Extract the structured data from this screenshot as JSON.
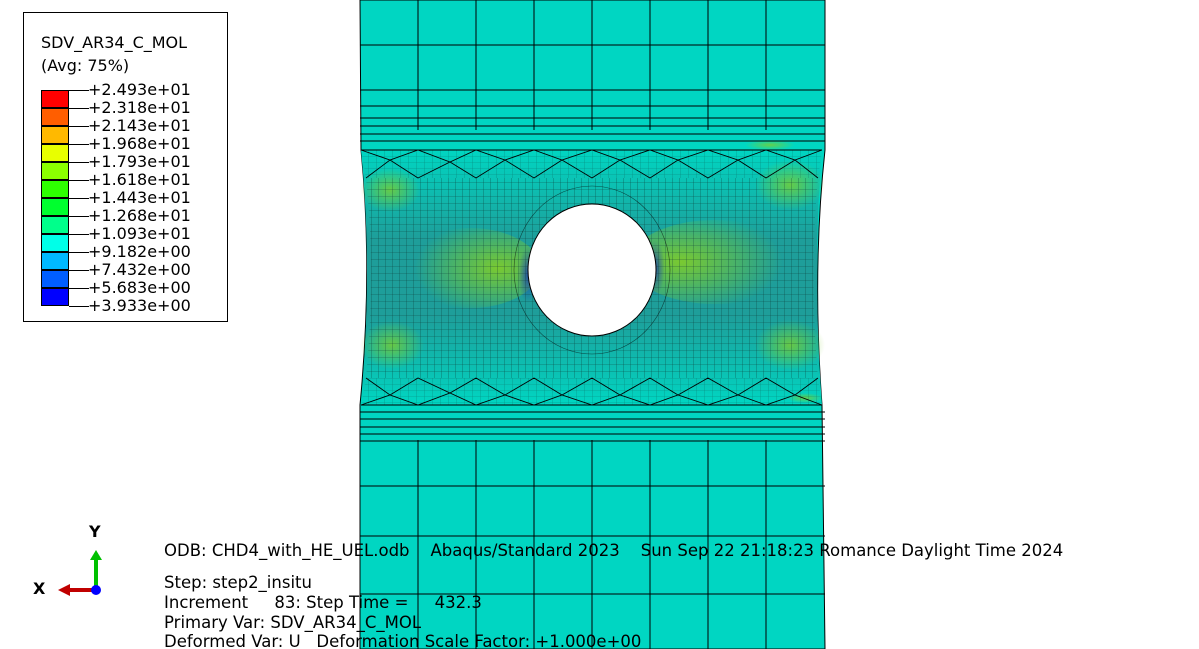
{
  "legend": {
    "variable": "SDV_AR34_C_MOL",
    "averaging": "(Avg: 75%)",
    "bands": [
      {
        "value": "+2.493e+01",
        "color": "#ff0000"
      },
      {
        "value": "+2.318e+01",
        "color": "#ff5e00"
      },
      {
        "value": "+2.143e+01",
        "color": "#ffb900"
      },
      {
        "value": "+1.968e+01",
        "color": "#e8ff00"
      },
      {
        "value": "+1.793e+01",
        "color": "#8bff00"
      },
      {
        "value": "+1.618e+01",
        "color": "#2eff00"
      },
      {
        "value": "+1.443e+01",
        "color": "#00ff2e"
      },
      {
        "value": "+1.268e+01",
        "color": "#00ff8b"
      },
      {
        "value": "+1.093e+01",
        "color": "#00ffe8"
      },
      {
        "value": "+9.182e+00",
        "color": "#00b9ff"
      },
      {
        "value": "+7.432e+00",
        "color": "#005eff"
      },
      {
        "value": "+5.683e+00",
        "color": "#0000ff"
      },
      {
        "value": "+3.933e+00",
        "color": null
      }
    ]
  },
  "info": {
    "odb_line": "ODB: CHD4_with_HE_UEL.odb    Abaqus/Standard 2023    Sun Sep 22 21:18:23 Romance Daylight Time 2024",
    "step_line": "Step: step2_insitu",
    "increment_line": "Increment     83: Step Time =     432.3",
    "primary_line": "Primary Var: SDV_AR34_C_MOL",
    "deformed_line": "Deformed Var: U   Deformation Scale Factor: +1.000e+00"
  },
  "triad": {
    "x_label": "X",
    "y_label": "Y",
    "x_color": "#c00000",
    "y_color": "#00c000",
    "z_color": "#0000ff"
  },
  "colors": {
    "base_contour": "#00d6c2",
    "mid_contour": "#1ea7a0",
    "hot_contour": "#7ccd2e",
    "cold_contour": "#1a4fb0",
    "mesh_line": "#000000"
  }
}
